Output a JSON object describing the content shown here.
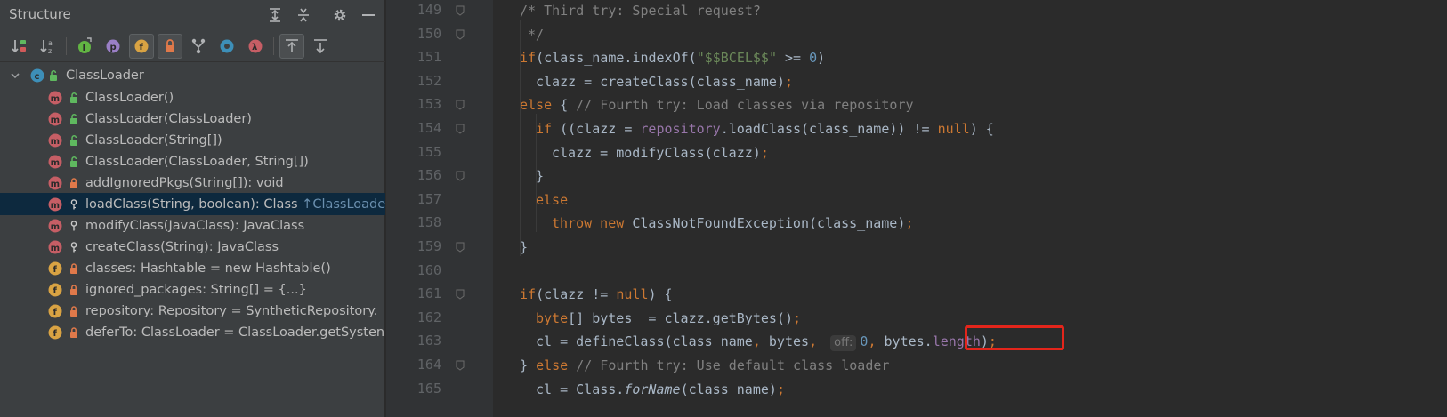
{
  "structure": {
    "title": "Structure",
    "header_buttons": [
      {
        "icon": "expand-all-icon"
      },
      {
        "icon": "collapse-all-icon"
      },
      {
        "icon": "gear-icon"
      },
      {
        "icon": "minimize-icon"
      }
    ],
    "toolbar": [
      {
        "icon": "sort-by-visibility-icon",
        "active": false
      },
      {
        "icon": "sort-alphabetically-icon",
        "active": false
      },
      {
        "icon": "show-inherited-icon",
        "active": false,
        "letter": "I"
      },
      {
        "icon": "show-properties-icon",
        "active": false,
        "letter": "p"
      },
      {
        "icon": "show-fields-icon",
        "active": true,
        "letter": "f"
      },
      {
        "icon": "show-non-public-icon",
        "active": true
      },
      {
        "icon": "show-anonymous-icon",
        "active": false
      },
      {
        "icon": "show-interfaces-icon",
        "active": false
      },
      {
        "icon": "show-lambdas-icon",
        "active": false,
        "letter": "λ"
      },
      {
        "icon": "autoscroll-to-source-icon",
        "active": true
      },
      {
        "icon": "autoscroll-from-source-icon",
        "active": false
      }
    ],
    "tree": {
      "root": {
        "kind": "c",
        "label": "ClassLoader",
        "visibility": "public"
      },
      "items": [
        {
          "kind": "m",
          "visibility": "public",
          "label": "ClassLoader()",
          "hint": "",
          "selected": false
        },
        {
          "kind": "m",
          "visibility": "public",
          "label": "ClassLoader(ClassLoader)",
          "hint": "",
          "selected": false
        },
        {
          "kind": "m",
          "visibility": "public",
          "label": "ClassLoader(String[])",
          "hint": "",
          "selected": false
        },
        {
          "kind": "m",
          "visibility": "public",
          "label": "ClassLoader(ClassLoader, String[])",
          "hint": "",
          "selected": false
        },
        {
          "kind": "m",
          "visibility": "private",
          "label": "addIgnoredPkgs(String[]): void",
          "hint": "",
          "selected": false
        },
        {
          "kind": "m",
          "visibility": "protected",
          "label": "loadClass(String, boolean): Class ",
          "hint": "↑ClassLoader",
          "selected": true
        },
        {
          "kind": "m",
          "visibility": "protected",
          "label": "modifyClass(JavaClass): JavaClass",
          "hint": "",
          "selected": false
        },
        {
          "kind": "m",
          "visibility": "protected",
          "label": "createClass(String): JavaClass",
          "hint": "",
          "selected": false
        },
        {
          "kind": "f",
          "visibility": "private",
          "label": "classes: Hashtable = new Hashtable()",
          "hint": "",
          "selected": false
        },
        {
          "kind": "f",
          "visibility": "private",
          "label": "ignored_packages: String[] = {...}",
          "hint": "",
          "selected": false
        },
        {
          "kind": "f",
          "visibility": "private",
          "label": "repository: Repository = SyntheticRepository.",
          "hint": "",
          "selected": false
        },
        {
          "kind": "f",
          "visibility": "private",
          "label": "deferTo: ClassLoader = ClassLoader.getSysten",
          "hint": "",
          "selected": false
        }
      ]
    }
  },
  "editor": {
    "lines": [
      {
        "n": "149",
        "indent": 4,
        "fold": true,
        "tokens": [
          [
            "cmt",
            "/* Third try: Special request?"
          ]
        ]
      },
      {
        "n": "150",
        "indent": 4,
        "fold": true,
        "tokens": [
          [
            "cmt",
            " */"
          ]
        ]
      },
      {
        "n": "151",
        "indent": 4,
        "fold": false,
        "tokens": [
          [
            "kw",
            "if"
          ],
          [
            "",
            "(class_name.indexOf("
          ],
          [
            "str",
            "\"$$BCEL$$\""
          ],
          [
            "",
            " >= "
          ],
          [
            "num",
            "0"
          ],
          [
            "",
            ")"
          ]
        ]
      },
      {
        "n": "152",
        "indent": 5,
        "fold": false,
        "tokens": [
          [
            "",
            "clazz = createClass(class_name)"
          ],
          [
            "kw",
            ";"
          ]
        ]
      },
      {
        "n": "153",
        "indent": 4,
        "fold": true,
        "tokens": [
          [
            "kw",
            "else"
          ],
          [
            "",
            " { "
          ],
          [
            "cmt",
            "// Fourth try: Load classes via repository"
          ]
        ]
      },
      {
        "n": "154",
        "indent": 5,
        "fold": true,
        "tokens": [
          [
            "kw",
            "if"
          ],
          [
            "",
            " ((clazz = "
          ],
          [
            "field",
            "repository"
          ],
          [
            "",
            ".loadClass(class_name)) != "
          ],
          [
            "kw",
            "null"
          ],
          [
            "",
            ") {"
          ]
        ]
      },
      {
        "n": "155",
        "indent": 6,
        "fold": false,
        "tokens": [
          [
            "",
            "clazz = modifyClass(clazz)"
          ],
          [
            "kw",
            ";"
          ]
        ]
      },
      {
        "n": "156",
        "indent": 5,
        "fold": true,
        "tokens": [
          [
            "",
            "}"
          ]
        ]
      },
      {
        "n": "157",
        "indent": 5,
        "fold": false,
        "tokens": [
          [
            "kw",
            "else"
          ]
        ]
      },
      {
        "n": "158",
        "indent": 6,
        "fold": false,
        "tokens": [
          [
            "kw",
            "throw new "
          ],
          [
            "",
            "ClassNotFoundException(class_name)"
          ],
          [
            "kw",
            ";"
          ]
        ]
      },
      {
        "n": "159",
        "indent": 4,
        "fold": true,
        "tokens": [
          [
            "",
            "}"
          ]
        ]
      },
      {
        "n": "160",
        "indent": 4,
        "fold": false,
        "tokens": []
      },
      {
        "n": "161",
        "indent": 4,
        "fold": true,
        "tokens": [
          [
            "kw",
            "if"
          ],
          [
            "",
            "(clazz != "
          ],
          [
            "kw",
            "null"
          ],
          [
            "",
            ") {"
          ]
        ]
      },
      {
        "n": "162",
        "indent": 5,
        "fold": false,
        "tokens": [
          [
            "kw",
            "byte"
          ],
          [
            "",
            "[] bytes  = clazz.getBytes()"
          ],
          [
            "kw",
            ";"
          ]
        ]
      },
      {
        "n": "163",
        "indent": 5,
        "fold": false,
        "tokens": [
          [
            "",
            "cl = "
          ],
          [
            "",
            "defineClass("
          ],
          [
            "",
            "class_name"
          ],
          [
            "kw",
            ", "
          ],
          [
            "",
            "bytes"
          ],
          [
            "kw",
            ", "
          ],
          [
            "hint",
            "off:"
          ],
          [
            "num",
            "0"
          ],
          [
            "kw",
            ", "
          ],
          [
            "",
            "bytes."
          ],
          [
            "field",
            "length"
          ],
          [
            "",
            ")"
          ],
          [
            "kw",
            ";"
          ]
        ]
      },
      {
        "n": "164",
        "indent": 4,
        "fold": true,
        "tokens": [
          [
            "",
            "} "
          ],
          [
            "kw",
            "else "
          ],
          [
            "cmt",
            "// Fourth try: Use default class loader"
          ]
        ]
      },
      {
        "n": "165",
        "indent": 5,
        "fold": false,
        "tokens": [
          [
            "",
            "cl = Class."
          ],
          [
            "ital",
            "forName"
          ],
          [
            "",
            "(class_name)"
          ],
          [
            "kw",
            ";"
          ]
        ]
      }
    ],
    "highlight_label": "defineClass",
    "colors": {
      "keyword": "#cc7832",
      "string": "#6a8759",
      "number": "#6897bb",
      "comment": "#808080",
      "field": "#9876aa",
      "highlight": "#e3251b"
    }
  }
}
